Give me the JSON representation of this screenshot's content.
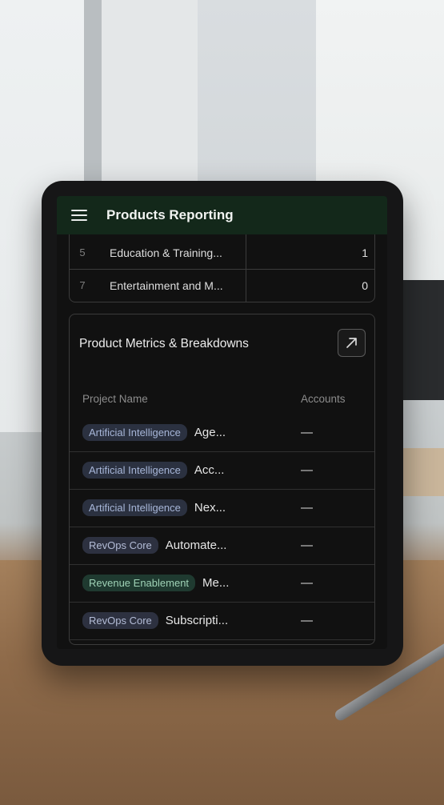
{
  "app": {
    "title": "Products Reporting"
  },
  "top_table": {
    "rows": [
      {
        "index": "5",
        "name": "Education & Training...",
        "value": "1"
      },
      {
        "index": "7",
        "name": "Entertainment and M...",
        "value": "0"
      }
    ]
  },
  "metrics": {
    "title": "Product Metrics & Breakdowns",
    "columns": {
      "name": "Project Name",
      "accounts": "Accounts"
    },
    "rows": [
      {
        "tag": "Artificial Intelligence",
        "name": "Age...",
        "accounts": "—"
      },
      {
        "tag": "Artificial Intelligence",
        "name": "Acc...",
        "accounts": "—"
      },
      {
        "tag": "Artificial Intelligence",
        "name": "Nex...",
        "accounts": "—"
      },
      {
        "tag": "RevOps Core",
        "name": "Automate...",
        "accounts": "—"
      },
      {
        "tag": "Revenue Enablement",
        "name": "Me...",
        "accounts": "—"
      },
      {
        "tag": "RevOps Core",
        "name": "Subscripti...",
        "accounts": "—"
      }
    ]
  },
  "colors": {
    "appbar": "#13281a",
    "screen_bg": "#111111",
    "tag_ai": "#2b3140",
    "tag_enablement": "#1f3a30"
  },
  "icons": {
    "menu": "hamburger-menu-icon",
    "open": "arrow-up-right-icon"
  }
}
